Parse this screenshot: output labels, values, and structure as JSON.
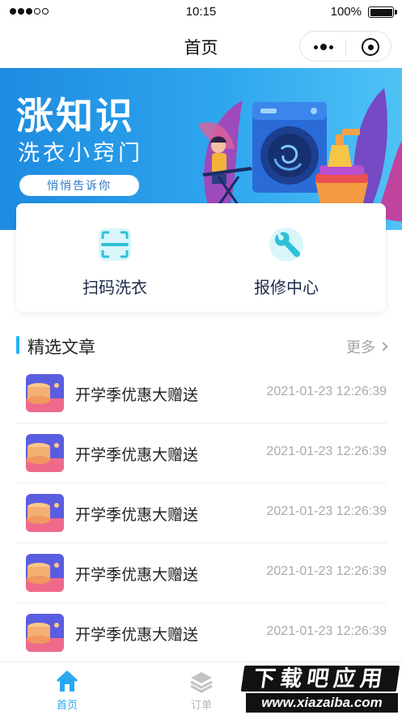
{
  "status_bar": {
    "time": "10:15",
    "battery": "100%"
  },
  "nav": {
    "title": "首页"
  },
  "banner": {
    "title": "涨知识",
    "subtitle": "洗衣小窍门",
    "pill": "悄悄告诉你",
    "colors": {
      "from": "#1e8be0",
      "to": "#4fc2f5"
    }
  },
  "services": [
    {
      "label": "扫码洗衣",
      "icon": "scan-icon"
    },
    {
      "label": "报修中心",
      "icon": "wrench-icon"
    }
  ],
  "articles_section": {
    "title": "精选文章",
    "more": "更多",
    "accent": "#23b3f0"
  },
  "articles": [
    {
      "title": "开学季优惠大赠送",
      "time": "2021-01-23 12:26:39"
    },
    {
      "title": "开学季优惠大赠送",
      "time": "2021-01-23 12:26:39"
    },
    {
      "title": "开学季优惠大赠送",
      "time": "2021-01-23 12:26:39"
    },
    {
      "title": "开学季优惠大赠送",
      "time": "2021-01-23 12:26:39"
    },
    {
      "title": "开学季优惠大赠送",
      "time": "2021-01-23 12:26:39"
    }
  ],
  "tab_bar": {
    "items": [
      {
        "label": "首页",
        "icon": "home-icon",
        "active": true,
        "color": "#29a8ef"
      },
      {
        "label": "订单",
        "icon": "layers-icon",
        "active": false,
        "color": "#b5b5b5"
      }
    ]
  },
  "watermark": {
    "top": "下载吧应用",
    "bottom": "www.xiazaiba.com"
  }
}
